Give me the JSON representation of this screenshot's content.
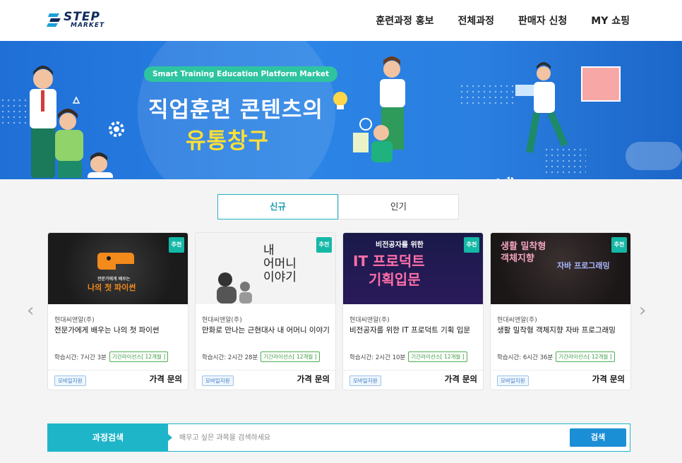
{
  "header": {
    "logo_step": "STEP",
    "logo_market": "MARKET",
    "nav": [
      "훈련과정 홍보",
      "전체과정",
      "판매자 신청",
      "MY 쇼핑"
    ]
  },
  "banner": {
    "pill": "Smart Training Education Platform Market",
    "title_line1": "직업훈련 콘텐츠의",
    "title_line2": "유통창구"
  },
  "tabs": [
    {
      "label": "신규",
      "active": true
    },
    {
      "label": "인기",
      "active": false
    }
  ],
  "arrows": {
    "prev": "‹",
    "next": "›"
  },
  "cards": [
    {
      "badge": "추천",
      "thumb_lines": [
        "전문가에게 배우는",
        "나의 첫 파이썬"
      ],
      "vendor": "현대씨앤알(주)",
      "title": "전문가에게 배우는 나의 첫 파이썬",
      "time": "학습시간: 7시간 3분",
      "license": "기간라이선스[ 12개월 ]",
      "mobile": "모바일지원",
      "price": "가격 문의"
    },
    {
      "badge": "추천",
      "thumb_lines": [
        "내",
        "어머니",
        "이야기"
      ],
      "vendor": "현대씨앤알(주)",
      "title": "만화로 만나는 근현대사 내 어머니 이야기",
      "time": "학습시간: 2시간 28분",
      "license": "기간라이선스[ 12개월 ]",
      "mobile": "모바일지원",
      "price": "가격 문의"
    },
    {
      "badge": "추천",
      "thumb_lines": [
        "비전공자를 위한",
        "IT 프로덕트",
        "기획입문"
      ],
      "vendor": "현대씨앤알(주)",
      "title": "비전공자를 위한 IT 프로덕트 기획 입문",
      "time": "학습시간: 2시간 10분",
      "license": "기간라이선스[ 12개월 ]",
      "mobile": "모바일지원",
      "price": "가격 문의"
    },
    {
      "badge": "추천",
      "thumb_lines": [
        "생활 밀착형",
        "객체지향",
        "자바 프로그래밍"
      ],
      "vendor": "현대씨앤알(주)",
      "title": "생활 밀착형 객체지향 자바 프로그래밍",
      "time": "학습시간: 6시간 36분",
      "license": "기간라이선스[ 12개월 ]",
      "mobile": "모바일지원",
      "price": "가격 문의"
    }
  ],
  "search": {
    "label": "과정검색",
    "placeholder": "배우고 싶은 과목을 검색하세요",
    "button": "검색"
  },
  "colors": {
    "accent": "#1fb5c9",
    "banner": "#2b84e6",
    "badge": "#14b8a6",
    "search_button": "#1b8fd6"
  }
}
